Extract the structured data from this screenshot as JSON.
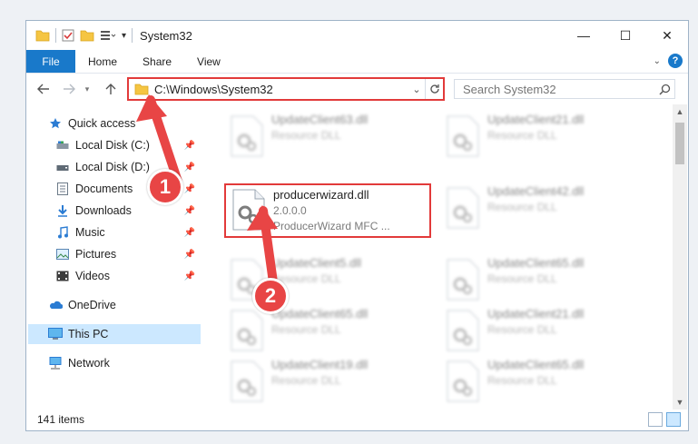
{
  "window": {
    "title": "System32",
    "controls": {
      "minimize": "—",
      "maximize": "☐",
      "close": "✕"
    }
  },
  "ribbon": {
    "file_tab": "File",
    "tabs": [
      "Home",
      "Share",
      "View"
    ],
    "help": "?"
  },
  "nav": {
    "address": "C:\\Windows\\System32",
    "search_placeholder": "Search System32"
  },
  "sidebar": {
    "items": [
      {
        "label": "Quick access",
        "icon": "star-icon",
        "pinned": false
      },
      {
        "label": "Local Disk (C:)",
        "icon": "drive-icon",
        "pinned": true
      },
      {
        "label": "Local Disk (D:)",
        "icon": "drive-icon",
        "pinned": true
      },
      {
        "label": "Documents",
        "icon": "documents-icon",
        "pinned": true
      },
      {
        "label": "Downloads",
        "icon": "downloads-icon",
        "pinned": true
      },
      {
        "label": "Music",
        "icon": "music-icon",
        "pinned": true
      },
      {
        "label": "Pictures",
        "icon": "pictures-icon",
        "pinned": true
      },
      {
        "label": "Videos",
        "icon": "videos-icon",
        "pinned": true
      },
      {
        "label": "OneDrive",
        "icon": "onedrive-icon",
        "pinned": false
      },
      {
        "label": "This PC",
        "icon": "pc-icon",
        "pinned": false,
        "selected": true
      },
      {
        "label": "Network",
        "icon": "network-icon",
        "pinned": false
      }
    ]
  },
  "files": {
    "left_column": [
      {
        "name": "UpdateClient63.dll",
        "sub": "Resource DLL",
        "blurred": true
      },
      {
        "name": "producerwizard.dll",
        "version": "2.0.0.0",
        "sub": "ProducerWizard MFC ...",
        "blurred": false,
        "selected": true
      },
      {
        "name": "UpdateClient5.dll",
        "sub": "Resource DLL",
        "blurred": true
      },
      {
        "name": "UpdateClient65.dll",
        "sub": "Resource DLL",
        "blurred": true
      },
      {
        "name": "UpdateClient19.dll",
        "sub": "Resource DLL",
        "blurred": true
      }
    ],
    "right_column": [
      {
        "name": "UpdateClient21.dll",
        "sub": "Resource DLL",
        "blurred": true
      },
      {
        "name": "UpdateClient42.dll",
        "sub": "Resource DLL",
        "blurred": true
      },
      {
        "name": "UpdateClient65.dll",
        "sub": "Resource DLL",
        "blurred": true
      },
      {
        "name": "UpdateClient21.dll",
        "sub": "Resource DLL",
        "blurred": true
      },
      {
        "name": "UpdateClient65.dll",
        "sub": "Resource DLL",
        "blurred": true
      }
    ]
  },
  "status": {
    "item_count": "141 items"
  },
  "annotations": {
    "step1": "1",
    "step2": "2",
    "color": "#e84545"
  },
  "colors": {
    "accent": "#1979ca",
    "highlight": "#e23a3a",
    "selection": "#cce8ff"
  }
}
